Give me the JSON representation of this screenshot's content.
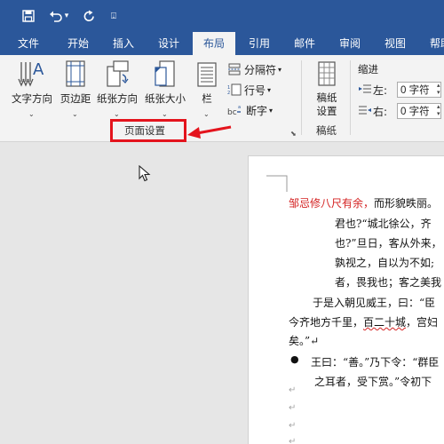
{
  "qat": {
    "save_icon": "save-icon",
    "undo_icon": "undo-icon",
    "undo_caret": "▾",
    "redo_icon": "redo-icon",
    "customize": "⍗"
  },
  "tabs": [
    "文件",
    "开始",
    "插入",
    "设计",
    "布局",
    "引用",
    "邮件",
    "审阅",
    "视图",
    "帮助"
  ],
  "active_tab": "布局",
  "ribbon": {
    "text_direction": "文字方向",
    "margins": "页边距",
    "orientation": "纸张方向",
    "size": "纸张大小",
    "columns": "栏",
    "breaks": "分隔符",
    "line_numbers": "行号",
    "hyphenation": "断字",
    "page_setup_group": "页面设置",
    "manuscript_line1": "稿纸",
    "manuscript_line2": "设置",
    "manuscript_group": "稿纸",
    "indent_title": "缩进",
    "indent_left_label": "左:",
    "indent_left_value": "0 字符",
    "indent_right_label": "右:",
    "indent_right_value": "0 字符",
    "caret": "⌄",
    "caret_small": "▾",
    "launcher": "⬊"
  },
  "document": {
    "line1_red": "邹忌修八尺有余，",
    "line1_rest": "而形貌昳丽。",
    "line2": "君也?“城北徐公，齐",
    "line3": "也?”旦日，客从外来，",
    "line4": "孰视之，自以为不如;",
    "line5": "者，畏我也；客之美我",
    "line6": "于是入朝见威王，曰：“臣",
    "line7_a": "今齐地方千里，",
    "line7_b": "百二十城",
    "line7_c": "，宫妇",
    "line8": "矣。”↵",
    "bullet": "●",
    "line9": "王曰：“善。”乃下令：“群臣",
    "line10": "之耳者，受下赏。”令初下",
    "para_mark": "↵"
  },
  "colors": {
    "title_bar": "#2b579a",
    "ribbon_bg": "#f3f3f3",
    "highlight_box": "#e4141d",
    "arrow": "#e4141d",
    "red_text": "#d42222"
  }
}
